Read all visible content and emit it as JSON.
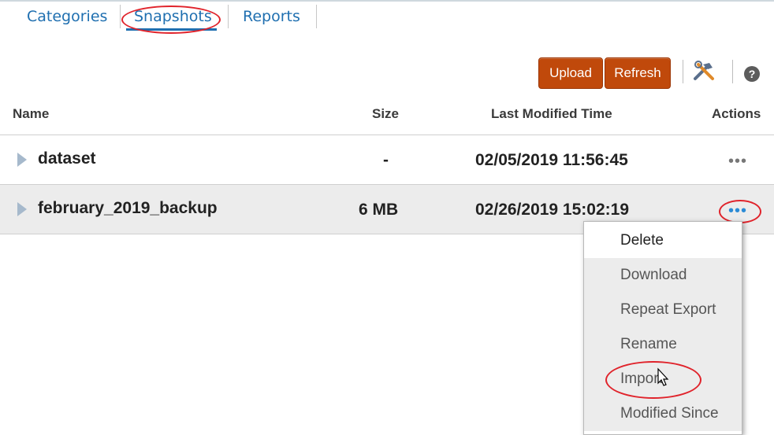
{
  "tabs": [
    {
      "label": "Categories"
    },
    {
      "label": "Snapshots",
      "active": true
    },
    {
      "label": "Reports"
    }
  ],
  "toolbar": {
    "upload_label": "Upload",
    "refresh_label": "Refresh",
    "tools_icon": "hammer-wrench-icon",
    "help_icon": "help-icon"
  },
  "table": {
    "columns": [
      "Name",
      "Size",
      "Last Modified Time",
      "Actions"
    ],
    "rows": [
      {
        "name": "dataset",
        "size": "-",
        "modified": "02/05/2019 11:56:45",
        "actions": "•••"
      },
      {
        "name": "february_2019_backup",
        "size": "6 MB",
        "modified": "02/26/2019 15:02:19",
        "actions": "•••"
      }
    ]
  },
  "context_menu": {
    "items": [
      "Delete",
      "Download",
      "Repeat Export",
      "Rename",
      "Import",
      "Modified Since"
    ]
  },
  "colors": {
    "accent_button": "#c0490b",
    "link": "#1f6fb0",
    "annotation": "#e0232b"
  }
}
